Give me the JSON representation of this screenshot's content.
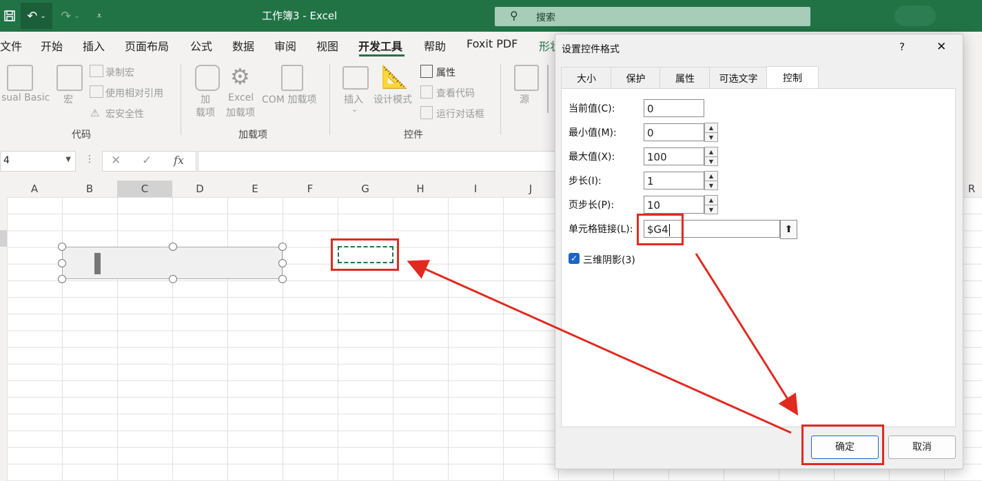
{
  "window": {
    "title": "工作簿3  -  Excel",
    "search_placeholder": "搜索"
  },
  "ribbon_tabs": [
    "文件",
    "开始",
    "插入",
    "页面布局",
    "公式",
    "数据",
    "审阅",
    "视图",
    "开发工具",
    "帮助",
    "Foxit PDF",
    "形状"
  ],
  "active_tab": "开发工具",
  "ribbon": {
    "code": {
      "visual_basic": "sual Basic",
      "macros": "宏",
      "record_macro": "录制宏",
      "relative_ref": "使用相对引用",
      "macro_security": "宏安全性",
      "group_label": "代码"
    },
    "addins": {
      "addins_line1": "加",
      "addins_line2": "载项",
      "excel_addins_line1": "Excel",
      "excel_addins_line2": "加载项",
      "com_addins": "COM 加载项",
      "group_label": "加载项"
    },
    "controls": {
      "insert": "插入",
      "design_mode": "设计模式",
      "properties": "属性",
      "view_code": "查看代码",
      "run_dialog": "运行对话框",
      "group_label": "控件"
    },
    "xml": {
      "source": "源"
    }
  },
  "formula_bar": {
    "name_box": "4",
    "fx": "fx"
  },
  "columns": [
    "A",
    "B",
    "C",
    "D",
    "E",
    "F",
    "G",
    "H",
    "I",
    "J",
    "R"
  ],
  "dialog": {
    "title": "设置控件格式",
    "help": "?",
    "close": "✕",
    "tabs": [
      "大小",
      "保护",
      "属性",
      "可选文字",
      "控制"
    ],
    "active_tab": "控制",
    "fields": {
      "current_value": {
        "label": "当前值(C):",
        "value": "0"
      },
      "min_value": {
        "label": "最小值(M):",
        "value": "0"
      },
      "max_value": {
        "label": "最大值(X):",
        "value": "100"
      },
      "step": {
        "label": "步长(I):",
        "value": "1"
      },
      "page_step": {
        "label": "页步长(P):",
        "value": "10"
      },
      "cell_link": {
        "label": "单元格链接(L):",
        "value": "$G4"
      }
    },
    "shading": {
      "label": "三维阴影(3)",
      "checked": true
    },
    "ok": "确定",
    "cancel": "取消"
  },
  "colors": {
    "excel_green": "#217346",
    "annotation_red": "#e02a20"
  }
}
